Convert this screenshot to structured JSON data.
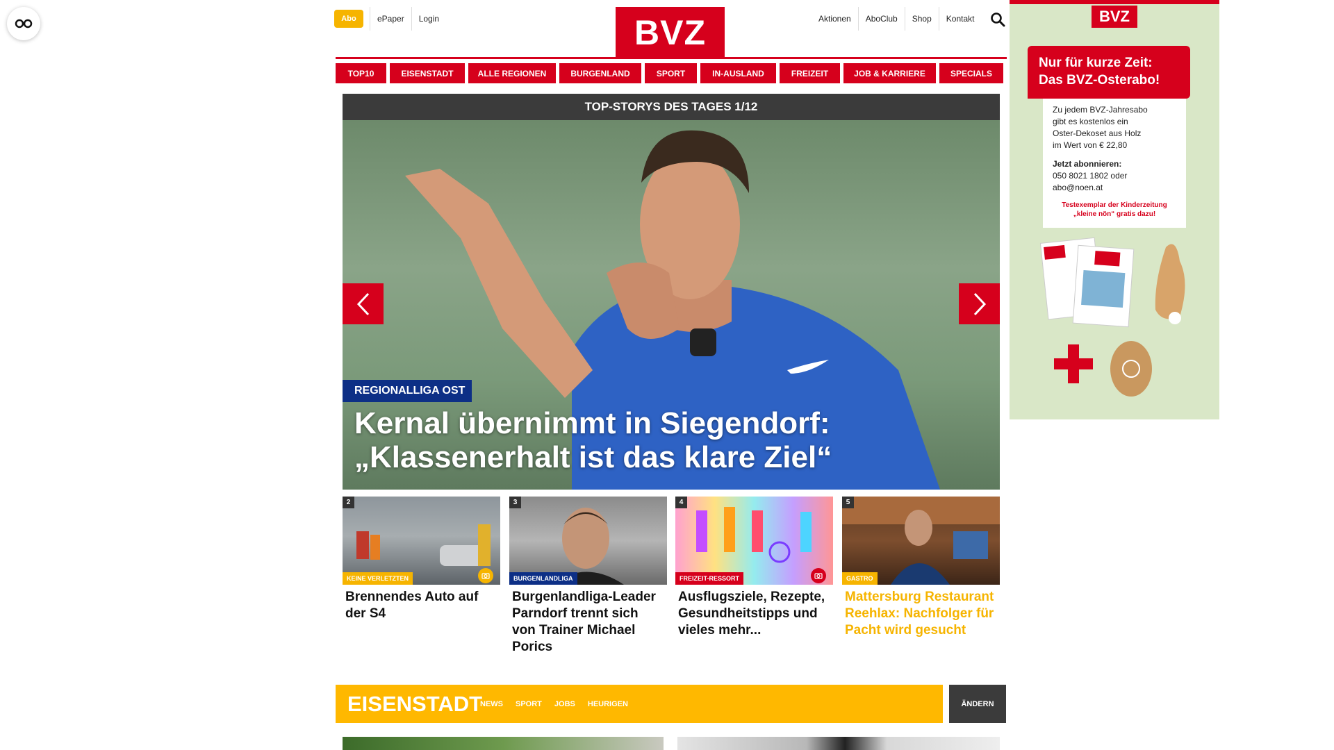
{
  "header": {
    "abo": "Abo",
    "left_links": [
      "ePaper",
      "Login"
    ],
    "right_links": [
      "Aktionen",
      "AboClub",
      "Shop",
      "Kontakt"
    ],
    "logo": "BVZ"
  },
  "nav": {
    "tabs": [
      "TOP10",
      "EISENSTADT",
      "ALLE REGIONEN",
      "BURGENLAND",
      "SPORT",
      "IN-AUSLAND",
      "FREIZEIT",
      "JOB & KARRIERE",
      "SPECIALS"
    ]
  },
  "hero": {
    "bar_title": "TOP-STORYS DES TAGES 1/12",
    "kicker": "REGIONALLIGA OST",
    "title_line1": "Kernal übernimmt in Siegendorf:",
    "title_line2": "„Klassenerhalt ist das klare Ziel“"
  },
  "stories": [
    {
      "num": "2",
      "kicker": "KEINE VERLETZTEN",
      "kicker_color": "#f6b400",
      "title": "Brennendes Auto auf der S4",
      "title_color": "#111111"
    },
    {
      "num": "3",
      "kicker": "BURGENLANDLIGA",
      "kicker_color": "#0d2f86",
      "title": "Burgenlandliga-Leader Parndorf trennt sich von Trainer Michael Porics",
      "title_color": "#111111"
    },
    {
      "num": "4",
      "kicker": "FREIZEIT-RESSORT",
      "kicker_color": "#d6001c",
      "title": "Ausflugsziele, Rezepte, Gesundheitstipps und vieles mehr...",
      "title_color": "#111111"
    },
    {
      "num": "5",
      "kicker": "GASTRO",
      "kicker_color": "#f6b400",
      "title": "Mattersburg Restaurant Reehlax: Nachfolger für Pacht wird gesucht",
      "title_color": "#f6b400"
    }
  ],
  "region": {
    "title": "EISENSTADT",
    "links": [
      "NEWS",
      "SPORT",
      "JOBS",
      "HEURIGEN"
    ],
    "change": "ÄNDERN"
  },
  "ad": {
    "logo": "BVZ",
    "headline_line1": "Nur für kurze Zeit:",
    "headline_line2": "Das BVZ-Osterabo!",
    "body": [
      "Zu jedem BVZ-Jahresabo",
      "gibt es kostenlos ein",
      "Oster-Dekoset aus Holz",
      "im Wert von € 22,80"
    ],
    "cta": "Jetzt abonnieren:",
    "contact": [
      "050 8021 1802 oder",
      "abo@noen.at"
    ],
    "note_line1": "Testexemplar der Kinderzeitung",
    "note_line2": "„kleine nön“ gratis dazu!"
  },
  "colors": {
    "brand_red": "#d6001c",
    "yellow": "#ffb800",
    "navy": "#0d2f86",
    "dark": "#3b3b3b"
  }
}
